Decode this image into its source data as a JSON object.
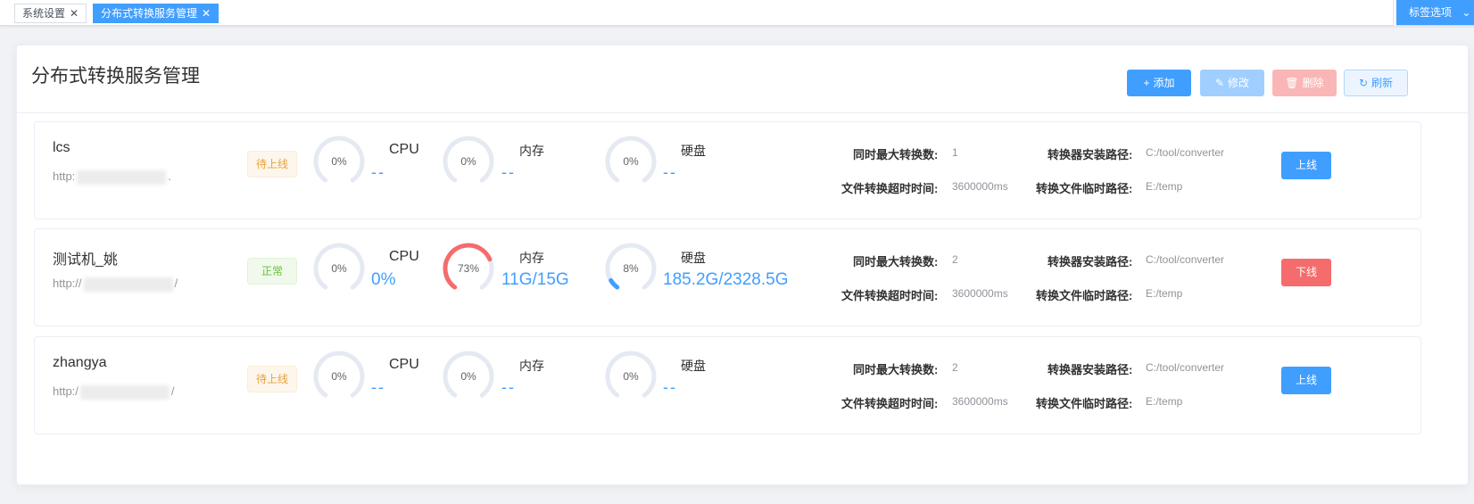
{
  "tabs": [
    {
      "label": "系统设置",
      "active": false
    },
    {
      "label": "分布式转换服务管理",
      "active": true
    }
  ],
  "tag_options_label": "标签选项",
  "page_title": "分布式转换服务管理",
  "toolbar": {
    "add_label": "添加",
    "edit_label": "修改",
    "delete_label": "删除",
    "refresh_label": "刷新"
  },
  "labels": {
    "cpu": "CPU",
    "memory": "内存",
    "disk": "硬盘",
    "max_conversions": "同时最大转换数:",
    "install_path": "转换器安装路径:",
    "timeout": "文件转换超时时间:",
    "temp_path": "转换文件临时路径:"
  },
  "servers": [
    {
      "name": "lcs",
      "url_prefix": "http:",
      "url_suffix": ".",
      "status": "待上线",
      "cpu_percent": 0,
      "cpu_label": "0%",
      "cpu_value": "--",
      "mem_percent": 0,
      "mem_label": "0%",
      "mem_value": "--",
      "disk_percent": 0,
      "disk_label": "0%",
      "disk_value": "--",
      "max_conversions": "1",
      "install_path": "C:/tool/converter",
      "timeout": "3600000ms",
      "temp_path": "E:/temp",
      "action": "上线"
    },
    {
      "name": "测试机_姚",
      "url_prefix": "http://",
      "url_suffix": "/",
      "status": "正常",
      "cpu_percent": 0,
      "cpu_label": "0%",
      "cpu_value": "0%",
      "mem_percent": 73,
      "mem_label": "73%",
      "mem_value": "11G/15G",
      "disk_percent": 8,
      "disk_label": "8%",
      "disk_value": "185.2G/2328.5G",
      "max_conversions": "2",
      "install_path": "C:/tool/converter",
      "timeout": "3600000ms",
      "temp_path": "E:/temp",
      "action": "下线"
    },
    {
      "name": "zhangya",
      "url_prefix": "http:/",
      "url_suffix": "/",
      "status": "待上线",
      "cpu_percent": 0,
      "cpu_label": "0%",
      "cpu_value": "--",
      "mem_percent": 0,
      "mem_label": "0%",
      "mem_value": "--",
      "disk_percent": 0,
      "disk_label": "0%",
      "disk_value": "--",
      "max_conversions": "2",
      "install_path": "C:/tool/converter",
      "timeout": "3600000ms",
      "temp_path": "E:/temp",
      "action": "上线"
    }
  ],
  "colors": {
    "primary": "#409eff",
    "danger": "#f56c6c",
    "gauge_track": "#e5e9f2",
    "gauge_memory": "#f56c6c",
    "gauge_disk": "#409eff",
    "status_pending": "#e6a23c",
    "status_normal": "#67c23a"
  }
}
